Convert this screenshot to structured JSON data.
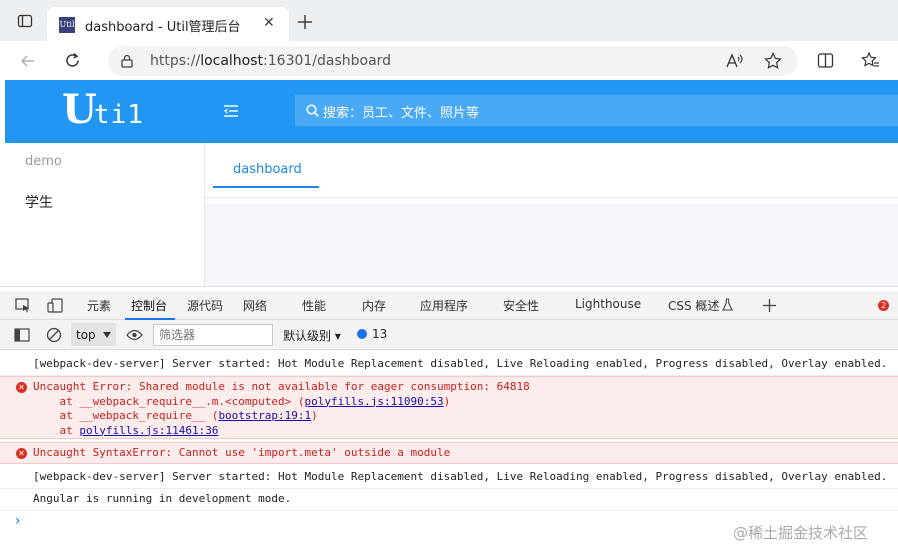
{
  "browser": {
    "tab_title": "dashboard - Util管理后台",
    "favicon_text": "Util",
    "url_prefix": "https://",
    "url_host": "localhost",
    "url_rest": ":16301/dashboard"
  },
  "app": {
    "logo_big": "U",
    "logo_small": "ti1",
    "search_placeholder": "搜索：员工、文件、照片等",
    "sidebar": {
      "group_label": "demo",
      "items": [
        {
          "label": "学生"
        }
      ]
    },
    "tabs": [
      {
        "label": "dashboard"
      }
    ]
  },
  "devtools": {
    "tabs": [
      {
        "label": "元素"
      },
      {
        "label": "控制台"
      },
      {
        "label": "源代码"
      },
      {
        "label": "网络"
      },
      {
        "label": "性能"
      },
      {
        "label": "内存"
      },
      {
        "label": "应用程序"
      },
      {
        "label": "安全性"
      },
      {
        "label": "Lighthouse"
      },
      {
        "label": "CSS 概述"
      }
    ],
    "error_badge": "2",
    "toolbar": {
      "context": "top",
      "filter_placeholder": "筛选器",
      "level": "默认级别",
      "message_count": "13"
    },
    "console": {
      "log1": "[webpack-dev-server] Server started: Hot Module Replacement disabled, Live Reloading enabled, Progress disabled, Overlay enabled.",
      "err1_msg": "Uncaught Error: Shared module is not available for eager consumption: 64818",
      "err1_l2a": "    at __webpack_require__.m.<computed> (",
      "err1_l2link": "polyfills.js:11090:53",
      "err1_l2b": ")",
      "err1_l3a": "    at __webpack_require__ (",
      "err1_l3link": "bootstrap:19:1",
      "err1_l3b": ")",
      "err1_l4a": "    at ",
      "err1_l4link": "polyfills.js:11461:36",
      "err2_msg": "Uncaught SyntaxError: Cannot use 'import.meta' outside a module",
      "log2": "[webpack-dev-server] Server started: Hot Module Replacement disabled, Live Reloading enabled, Progress disabled, Overlay enabled.",
      "log3": "Angular is running in development mode.",
      "prompt": "›"
    },
    "watermark": "@稀土掘金技术社区"
  }
}
